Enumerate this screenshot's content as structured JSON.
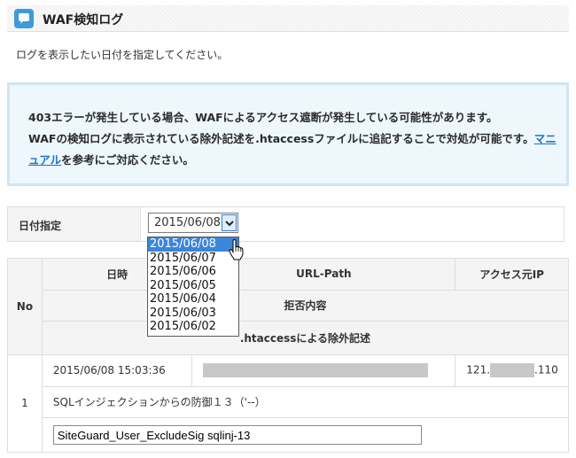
{
  "header": {
    "title": "WAF検知ログ",
    "icon": "speech-bubble-icon"
  },
  "intro": "ログを表示したい日付を指定してください。",
  "notice": {
    "text_1": "403エラーが発生している場合、WAFによるアクセス遮断が発生している可能性があります。",
    "text_2": "WAFの検知ログに表示されている除外記述を.htaccessファイルに追記することで対処が可能です。",
    "link_label": "マニュアル",
    "text_3": "を参考にご対応ください。"
  },
  "date_filter": {
    "label": "日付指定",
    "selected": "2015/06/08",
    "options": [
      "2015/06/08",
      "2015/06/07",
      "2015/06/06",
      "2015/06/05",
      "2015/06/04",
      "2015/06/03",
      "2015/06/02"
    ]
  },
  "table": {
    "headers": {
      "no": "No",
      "datetime": "日時",
      "url_path": "URL-Path",
      "source_ip": "アクセス元IP",
      "reason": "拒否内容",
      "exclusion": ".htaccessによる除外記述"
    },
    "rows": [
      {
        "no": "1",
        "datetime": "2015/06/08 15:03:36",
        "ip_prefix": "121.",
        "ip_suffix": ".110",
        "reason": "SQLインジェクションからの防御１３（'--）",
        "exclusion": "SiteGuard_User_ExcludeSig sqlinj-13"
      }
    ]
  },
  "colors": {
    "accent": "#3d9bd8",
    "link": "#1a73c8",
    "selection": "#3b86d8",
    "notice_bg": "#eef7fc"
  }
}
